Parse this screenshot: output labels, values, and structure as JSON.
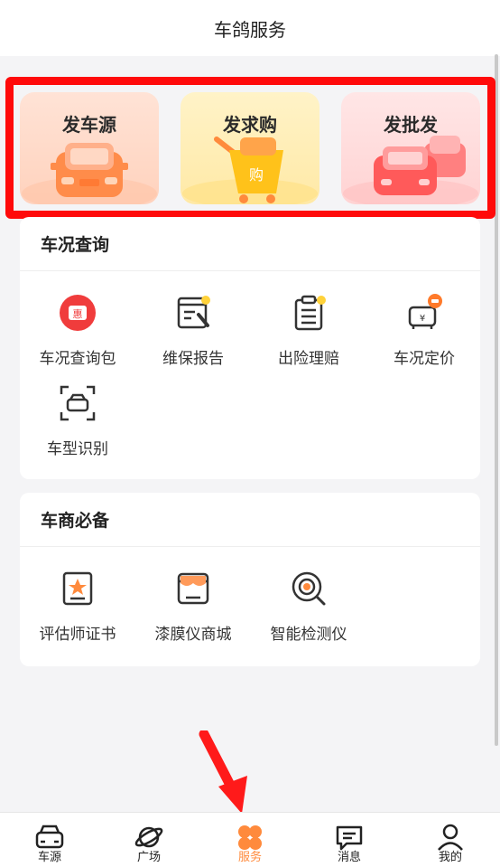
{
  "header": {
    "title": "车鸽服务"
  },
  "publish": [
    {
      "label": "发车源",
      "icon": "car-icon"
    },
    {
      "label": "发求购",
      "icon": "shopping-cart-icon",
      "badge": "购"
    },
    {
      "label": "发批发",
      "icon": "two-cars-icon"
    }
  ],
  "car_condition": {
    "title": "车况查询",
    "items": [
      {
        "label": "车况查询包",
        "icon": "ticket-badge-icon",
        "badge": "惠"
      },
      {
        "label": "维保报告",
        "icon": "maintenance-report-icon"
      },
      {
        "label": "出险理赔",
        "icon": "claim-document-icon"
      },
      {
        "label": "车况定价",
        "icon": "price-tag-car-icon",
        "badge": "¥"
      },
      {
        "label": "车型识别",
        "icon": "car-scan-icon"
      }
    ]
  },
  "dealer": {
    "title": "车商必备",
    "items": [
      {
        "label": "评估师证书",
        "icon": "certificate-icon"
      },
      {
        "label": "漆膜仪商城",
        "icon": "store-icon"
      },
      {
        "label": "智能检测仪",
        "icon": "detector-icon"
      }
    ]
  },
  "nav": [
    {
      "label": "车源",
      "icon": "car-nav-icon",
      "active": false
    },
    {
      "label": "广场",
      "icon": "planet-icon",
      "active": false
    },
    {
      "label": "服务",
      "icon": "clover-icon",
      "active": true
    },
    {
      "label": "消息",
      "icon": "message-icon",
      "active": false
    },
    {
      "label": "我的",
      "icon": "profile-icon",
      "active": false
    }
  ],
  "colors": {
    "accent": "#ff8a3c",
    "highlight": "#ff0a0a",
    "annotation_arrow": "#ff1a1a"
  }
}
